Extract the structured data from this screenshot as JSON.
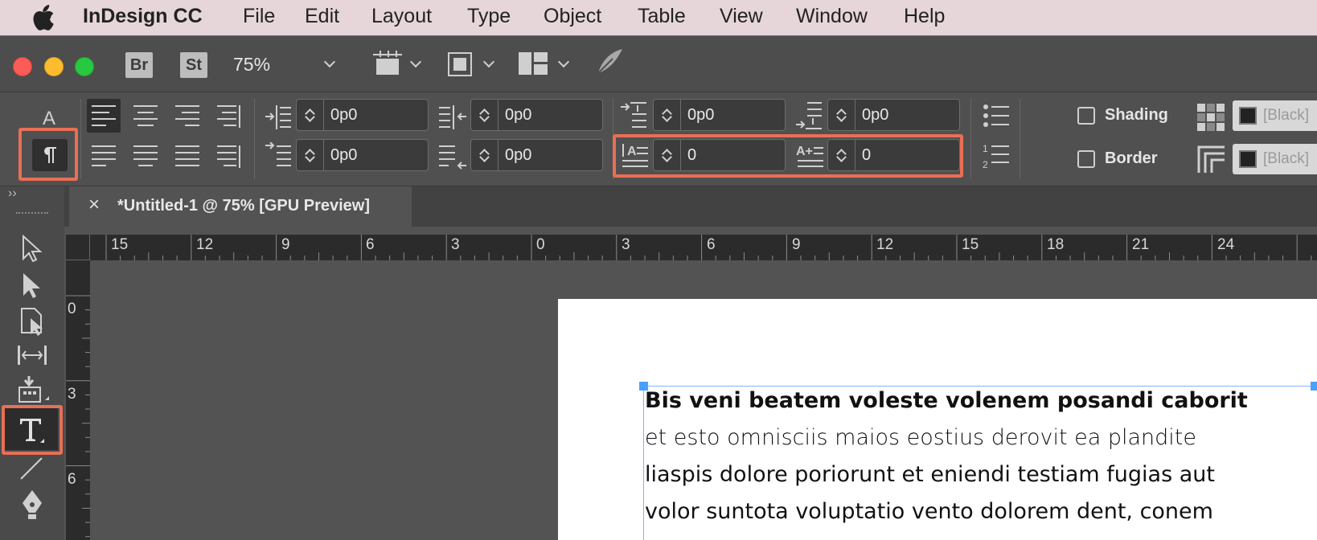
{
  "menubar": {
    "app_name": "InDesign CC",
    "items": [
      "File",
      "Edit",
      "Layout",
      "Type",
      "Object",
      "Table",
      "View",
      "Window",
      "Help"
    ]
  },
  "titlebar": {
    "bridge_label": "Br",
    "stock_label": "St",
    "zoom_value": "75%"
  },
  "control_panel": {
    "fields": {
      "left_indent": "0p0",
      "first_line_indent": "0p0",
      "right_indent": "0p0",
      "last_line_right_indent": "0p0",
      "space_before": "0p0",
      "space_after": "0p0",
      "drop_cap_lines": "0",
      "drop_cap_chars": "0"
    },
    "shading_label": "Shading",
    "border_label": "Border",
    "shading_swatch": "[Black]",
    "border_swatch": "[Black]"
  },
  "document_tab": {
    "title": "*Untitled-1 @ 75% [GPU Preview]",
    "close_glyph": "×"
  },
  "ruler": {
    "horizontal": [
      "15",
      "12",
      "9",
      "6",
      "3",
      "0",
      "3",
      "6",
      "9",
      "12",
      "15",
      "18",
      "21",
      "24"
    ],
    "vertical": [
      "0",
      "3",
      "6"
    ]
  },
  "text_frame": {
    "heading": "Bis veni beatem voleste volenem posandi caborit",
    "lines": [
      "et esto omnisciis maios eostius derovit ea plandite",
      "liaspis dolore poriorunt et eniendi testiam fugias aut",
      "volor suntota voluptatio vento dolorem dent, conem"
    ]
  },
  "colors": {
    "highlight": "#e86f55",
    "menubar_bg": "#e6d6d9",
    "panel_bg": "#505050",
    "pasteboard": "#535353",
    "frame_handle": "#4aa0ff"
  },
  "icons": [
    "apple-icon",
    "preflight-icon",
    "paragraph-icon",
    "character-icon",
    "selection-tool-icon",
    "direct-selection-tool-icon",
    "page-tool-icon",
    "gap-tool-icon",
    "content-collector-icon",
    "type-tool-icon",
    "line-tool-icon",
    "pen-tool-icon"
  ]
}
